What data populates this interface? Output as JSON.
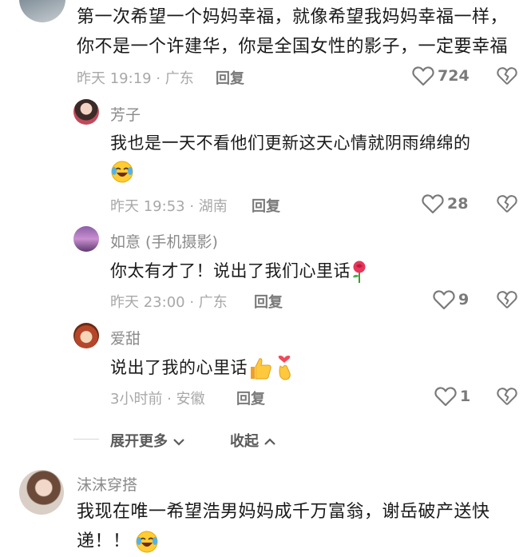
{
  "comment1": {
    "line1": "第一次希望一个妈妈幸福，就像希望我妈妈幸福一样，",
    "line2": "你不是一个许建华，你是全国女性的影子，一定要幸福",
    "meta": "昨天 19:19 · 广东",
    "reply": "回复",
    "likes": "724"
  },
  "replies": [
    {
      "name": "芳子",
      "text": "我也是一天不看他们更新这天心情就阴雨绵绵的",
      "meta": "昨天 19:53 · 湖南",
      "reply": "回复",
      "likes": "28",
      "emoji": "laughing-crying-emoji"
    },
    {
      "name": "如意 (手机摄影)",
      "text": "你太有才了！说出了我们心里话",
      "meta": "昨天 23:00 · 广东",
      "reply": "回复",
      "likes": "9",
      "emoji": "rose-emoji"
    },
    {
      "name": "爱甜",
      "text": "说出了我的心里话",
      "meta": "3小时前 · 安徽",
      "reply": "回复",
      "likes": "1",
      "emoji": "thumbs-up-emoji"
    }
  ],
  "expand": {
    "more": "展开更多",
    "collapse": "收起"
  },
  "comment2": {
    "name": "沫沫穿搭",
    "line1": "我现在唯一希望浩男妈妈成千万富翁，谢岳破产送快",
    "line2": "递！！"
  },
  "colors": {
    "accent_text": "#161823",
    "muted": "#a8a8a8"
  }
}
